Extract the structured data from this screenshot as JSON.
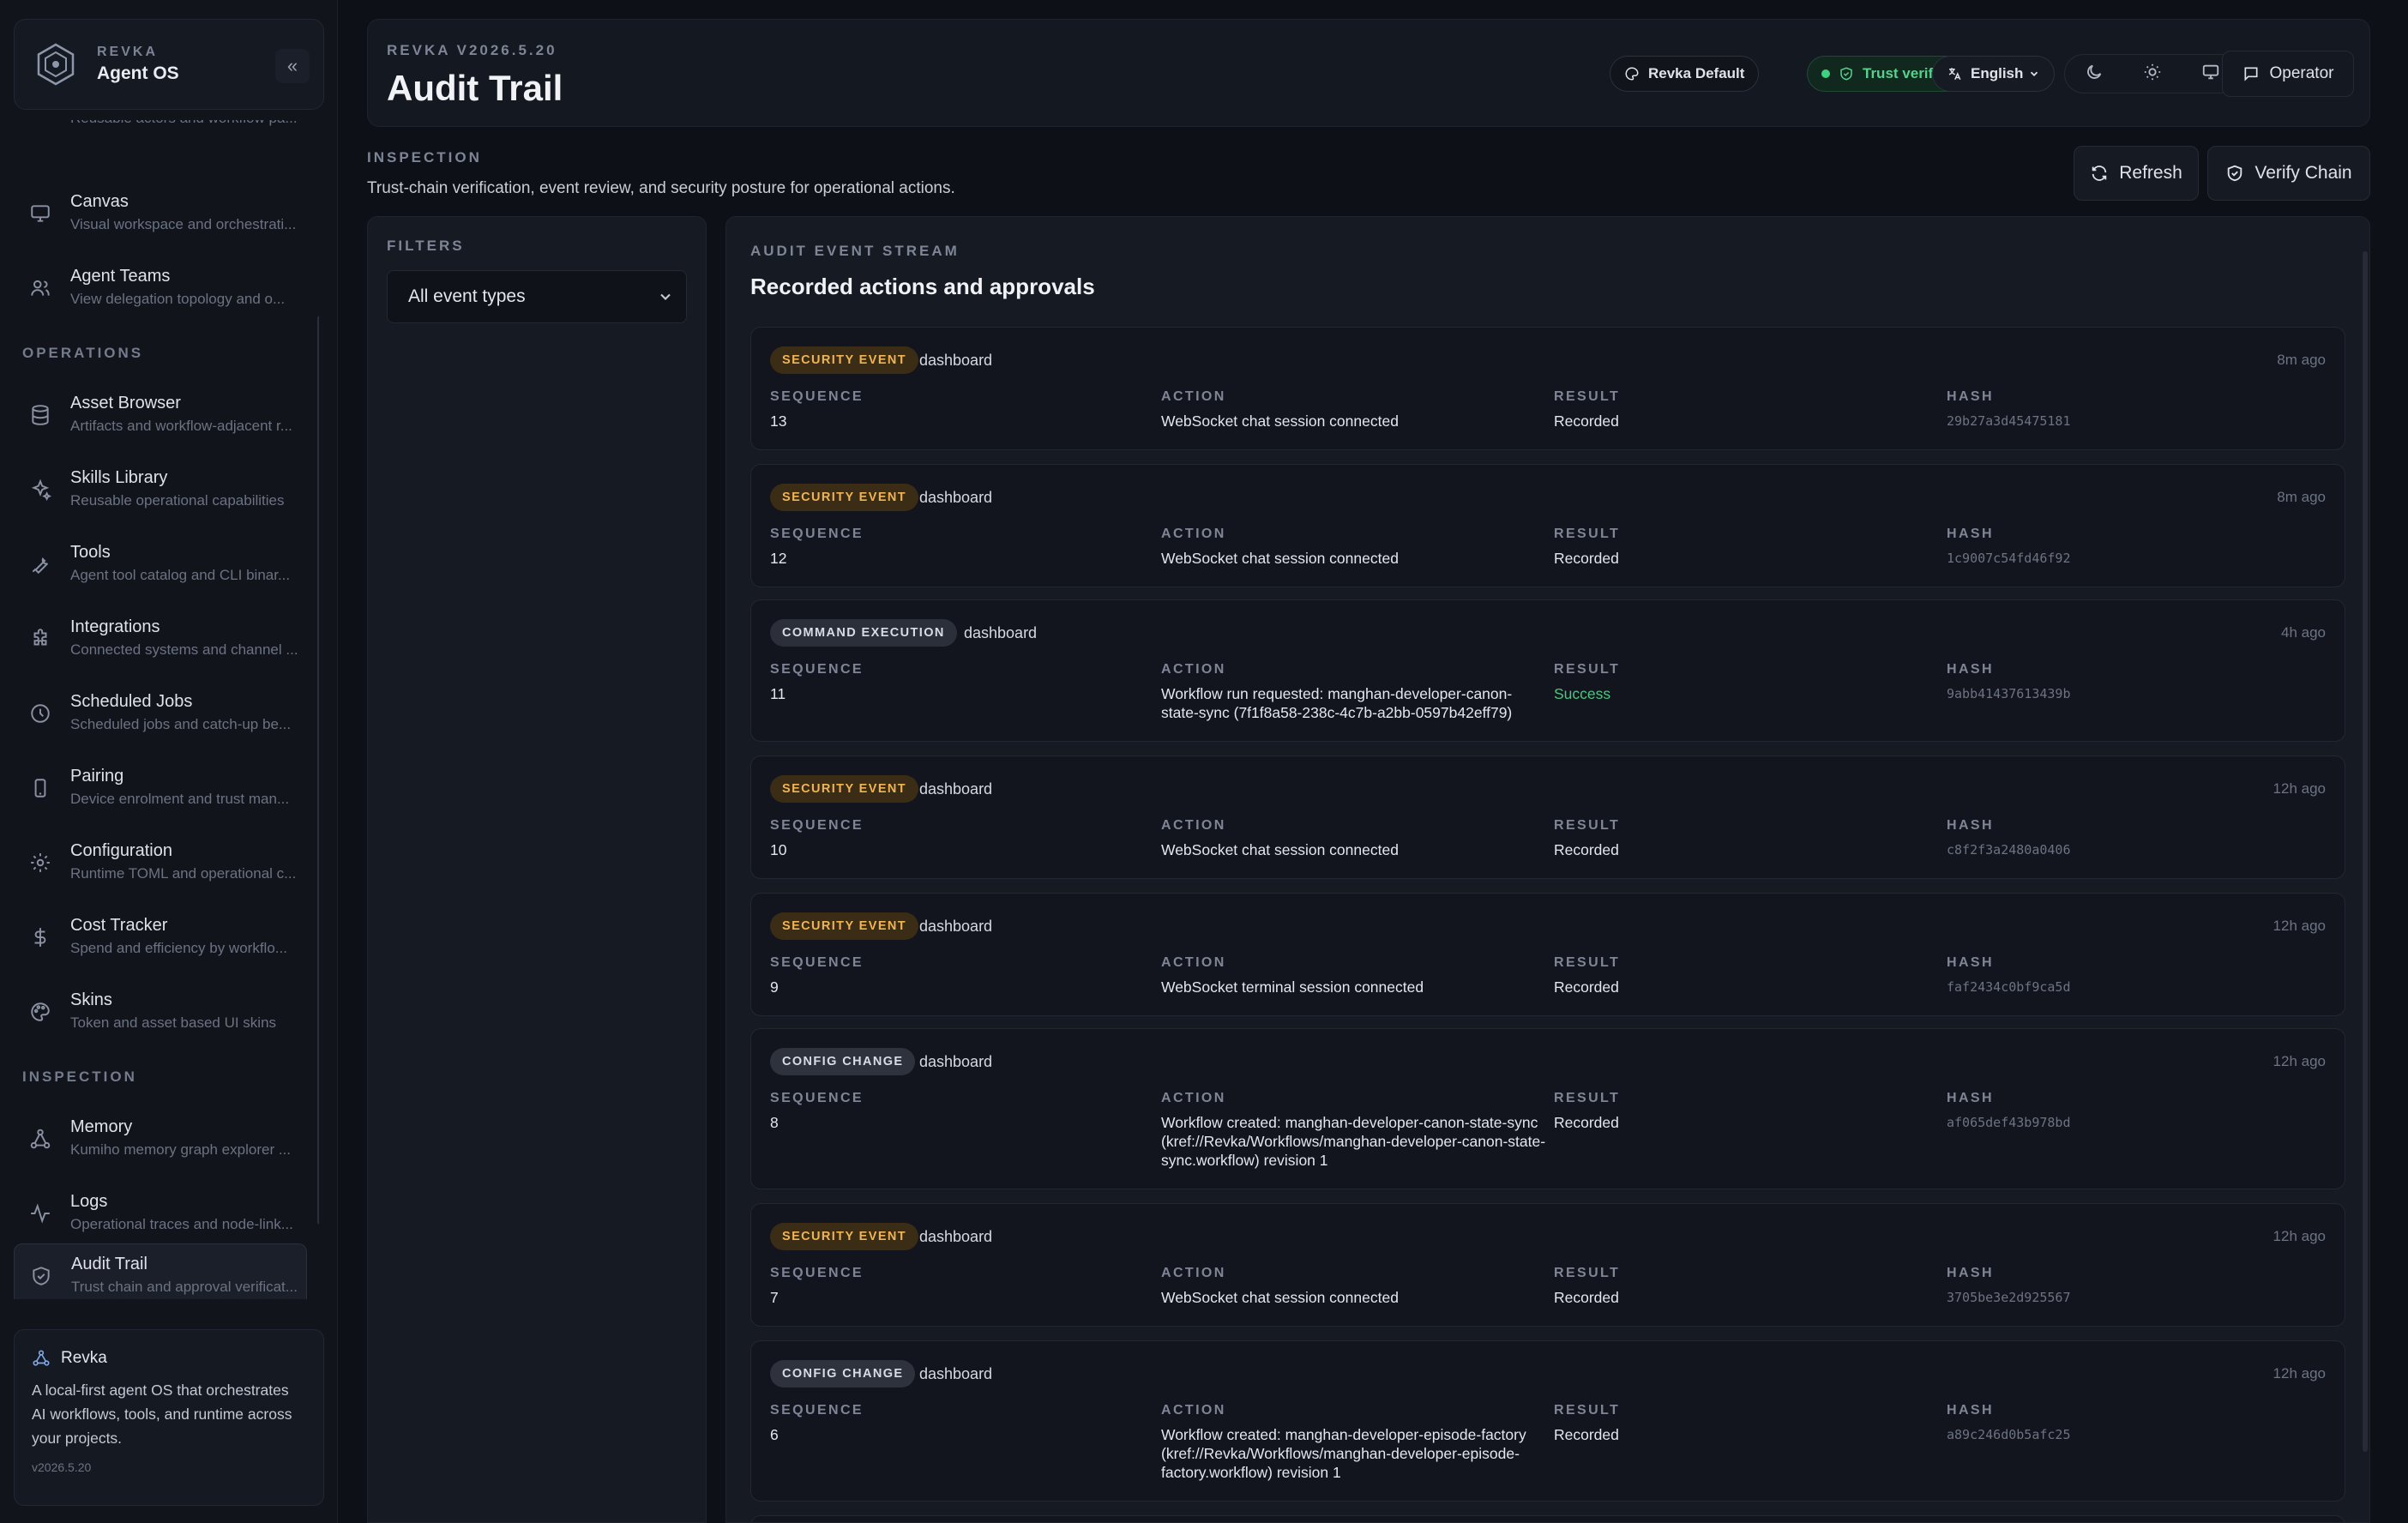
{
  "sidebar": {
    "brand_eyebrow": "REVKA",
    "brand_name": "Agent OS",
    "collapse_label": "«",
    "partial_item_desc": "Reusable actors and workflow pa...",
    "top_items": [
      {
        "title": "Canvas",
        "desc": "Visual workspace and orchestrati...",
        "icon": "monitor-icon"
      },
      {
        "title": "Agent Teams",
        "desc": "View delegation topology and o...",
        "icon": "users-icon"
      }
    ],
    "operations_label": "OPERATIONS",
    "operations_items": [
      {
        "title": "Asset Browser",
        "desc": "Artifacts and workflow-adjacent r...",
        "icon": "database-icon"
      },
      {
        "title": "Skills Library",
        "desc": "Reusable operational capabilities",
        "icon": "sparkles-icon"
      },
      {
        "title": "Tools",
        "desc": "Agent tool catalog and CLI binar...",
        "icon": "wrench-icon"
      },
      {
        "title": "Integrations",
        "desc": "Connected systems and channel ...",
        "icon": "puzzle-icon"
      },
      {
        "title": "Scheduled Jobs",
        "desc": "Scheduled jobs and catch-up be...",
        "icon": "clock-icon"
      },
      {
        "title": "Pairing",
        "desc": "Device enrolment and trust man...",
        "icon": "phone-icon"
      },
      {
        "title": "Configuration",
        "desc": "Runtime TOML and operational c...",
        "icon": "gear-icon"
      },
      {
        "title": "Cost Tracker",
        "desc": "Spend and efficiency by workflo...",
        "icon": "dollar-icon"
      },
      {
        "title": "Skins",
        "desc": "Token and asset based UI skins",
        "icon": "palette-icon"
      }
    ],
    "inspection_label": "INSPECTION",
    "inspection_items": [
      {
        "title": "Memory",
        "desc": "Kumiho memory graph explorer ...",
        "icon": "graph-icon"
      },
      {
        "title": "Logs",
        "desc": "Operational traces and node-link...",
        "icon": "activity-icon"
      },
      {
        "title": "Audit Trail",
        "desc": "Trust chain and approval verificat...",
        "icon": "shield-icon"
      }
    ],
    "about": {
      "title": "Revka",
      "text": "A local-first agent OS that orchestrates AI workflows, tools, and runtime across your projects.",
      "version": "v2026.5.20"
    }
  },
  "header": {
    "eyebrow": "REVKA V2026.5.20",
    "title": "Audit Trail",
    "skin_label": "Revka Default",
    "trust_label": "Trust verified",
    "language_label": "English",
    "operator_label": "Operator"
  },
  "page": {
    "eyebrow": "INSPECTION",
    "description": "Trust-chain verification, event review, and security posture for operational actions.",
    "refresh_label": "Refresh",
    "verify_label": "Verify Chain"
  },
  "filters": {
    "eyebrow": "FILTERS",
    "selected": "All event types"
  },
  "stream": {
    "eyebrow": "AUDIT EVENT STREAM",
    "heading": "Recorded actions and approvals",
    "col_sequence": "SEQUENCE",
    "col_action": "ACTION",
    "col_result": "RESULT",
    "col_hash": "HASH",
    "events": [
      {
        "type": "SECURITY EVENT",
        "kind": "security",
        "source": "dashboard",
        "time": "8m ago",
        "sequence": "13",
        "action": "WebSocket chat session connected",
        "result": "Recorded",
        "hash": "29b27a3d45475181"
      },
      {
        "type": "SECURITY EVENT",
        "kind": "security",
        "source": "dashboard",
        "time": "8m ago",
        "sequence": "12",
        "action": "WebSocket chat session connected",
        "result": "Recorded",
        "hash": "1c9007c54fd46f92"
      },
      {
        "type": "COMMAND EXECUTION",
        "kind": "command",
        "source": "dashboard",
        "time": "4h ago",
        "sequence": "11",
        "action": "Workflow run requested: manghan-developer-canon-state-sync (7f1f8a58-238c-4c7b-a2bb-0597b42eff79)",
        "result": "Success",
        "hash": "9abb41437613439b"
      },
      {
        "type": "SECURITY EVENT",
        "kind": "security",
        "source": "dashboard",
        "time": "12h ago",
        "sequence": "10",
        "action": "WebSocket chat session connected",
        "result": "Recorded",
        "hash": "c8f2f3a2480a0406"
      },
      {
        "type": "SECURITY EVENT",
        "kind": "security",
        "source": "dashboard",
        "time": "12h ago",
        "sequence": "9",
        "action": "WebSocket terminal session connected",
        "result": "Recorded",
        "hash": "faf2434c0bf9ca5d"
      },
      {
        "type": "CONFIG CHANGE",
        "kind": "config",
        "source": "dashboard",
        "time": "12h ago",
        "sequence": "8",
        "action": "Workflow created: manghan-developer-canon-state-sync (kref://Revka/Workflows/manghan-developer-canon-state-sync.workflow) revision 1",
        "result": "Recorded",
        "hash": "af065def43b978bd"
      },
      {
        "type": "SECURITY EVENT",
        "kind": "security",
        "source": "dashboard",
        "time": "12h ago",
        "sequence": "7",
        "action": "WebSocket chat session connected",
        "result": "Recorded",
        "hash": "3705be3e2d925567"
      },
      {
        "type": "CONFIG CHANGE",
        "kind": "config",
        "source": "dashboard",
        "time": "12h ago",
        "sequence": "6",
        "action": "Workflow created: manghan-developer-episode-factory (kref://Revka/Workflows/manghan-developer-episode-factory.workflow) revision 1",
        "result": "Recorded",
        "hash": "a89c246d0b5afc25"
      }
    ]
  }
}
